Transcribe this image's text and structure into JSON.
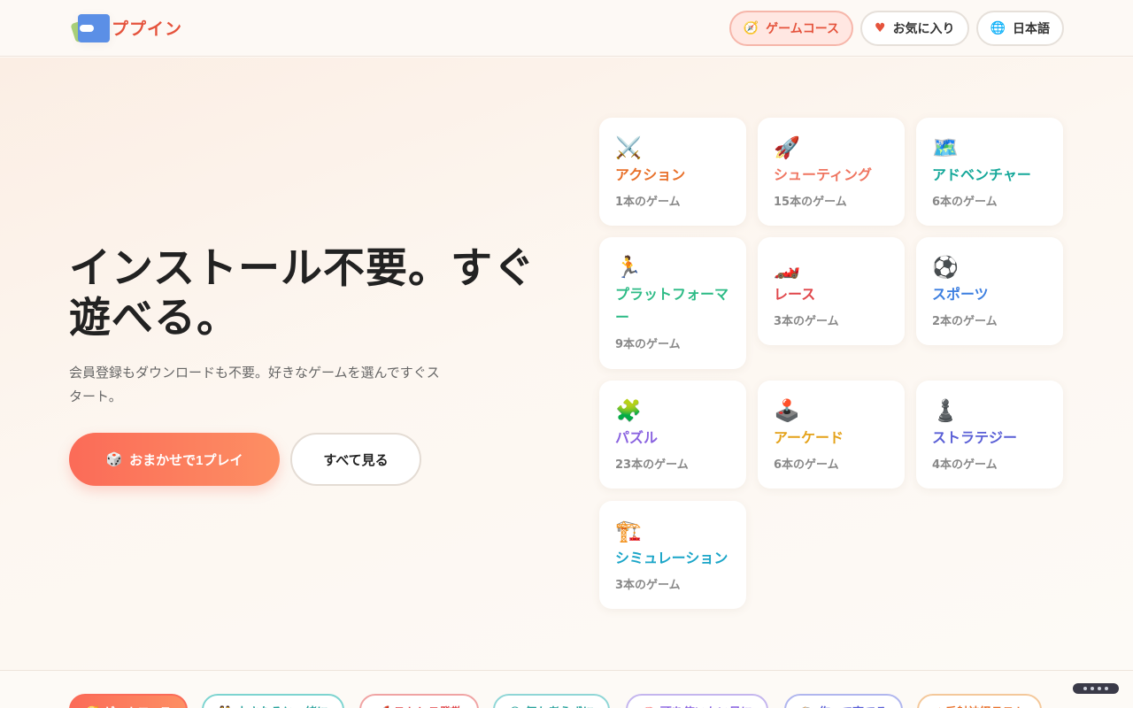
{
  "header": {
    "brand": "ププイン",
    "nav": [
      {
        "icon": "🧭",
        "label": "ゲームコース"
      },
      {
        "icon": "♥",
        "label": "お気に入り"
      },
      {
        "icon": "🌐",
        "label": "日本語"
      }
    ]
  },
  "hero": {
    "title": "インストール不要。すぐ遊べる。",
    "subtitle": "会員登録もダウンロードも不要。好きなゲームを選んですぐスタート。",
    "random_button": {
      "icon": "🎲",
      "label": "おまかせで1プレイ"
    },
    "all_button": "すべて見る"
  },
  "categories": [
    {
      "icon": "⚔️",
      "name": "アクション",
      "count": "1本のゲーム",
      "color": "#e8712b"
    },
    {
      "icon": "🚀",
      "name": "シューティング",
      "count": "15本のゲーム",
      "color": "#ef7560"
    },
    {
      "icon": "🗺️",
      "name": "アドベンチャー",
      "count": "6本のゲーム",
      "color": "#16a89a"
    },
    {
      "icon": "🏃",
      "name": "プラットフォーマー",
      "count": "9本のゲーム",
      "color": "#2dbb86"
    },
    {
      "icon": "🏎️",
      "name": "レース",
      "count": "3本のゲーム",
      "color": "#e0474b"
    },
    {
      "icon": "⚽",
      "name": "スポーツ",
      "count": "2本のゲーム",
      "color": "#3d7fe0"
    },
    {
      "icon": "🧩",
      "name": "パズル",
      "count": "23本のゲーム",
      "color": "#8a63e0"
    },
    {
      "icon": "🕹️",
      "name": "アーケード",
      "count": "6本のゲーム",
      "color": "#e4a21a"
    },
    {
      "icon": "♟️",
      "name": "ストラテジー",
      "count": "4本のゲーム",
      "color": "#5a5fd6"
    },
    {
      "icon": "🏗️",
      "name": "シミュレーション",
      "count": "3本のゲーム",
      "color": "#1aa5c8"
    }
  ],
  "strip": [
    {
      "label": "🧭 ゲームコース",
      "color": "#fb6b58"
    },
    {
      "label": "👫 小さなそと一緒に",
      "color": "#7dd4d0"
    },
    {
      "label": "🚀 ストレス発散",
      "color": "#f0a3a3"
    },
    {
      "label": "😊 何も考えずに",
      "color": "#8fd6d6"
    },
    {
      "label": "🧠 頭を使いたい日に",
      "color": "#c4b5ee"
    },
    {
      "label": "🏗️ 作って育てる",
      "color": "#b0b6ee"
    },
    {
      "label": "⚡ 反射神経テスト",
      "color": "#f4c89a"
    }
  ]
}
